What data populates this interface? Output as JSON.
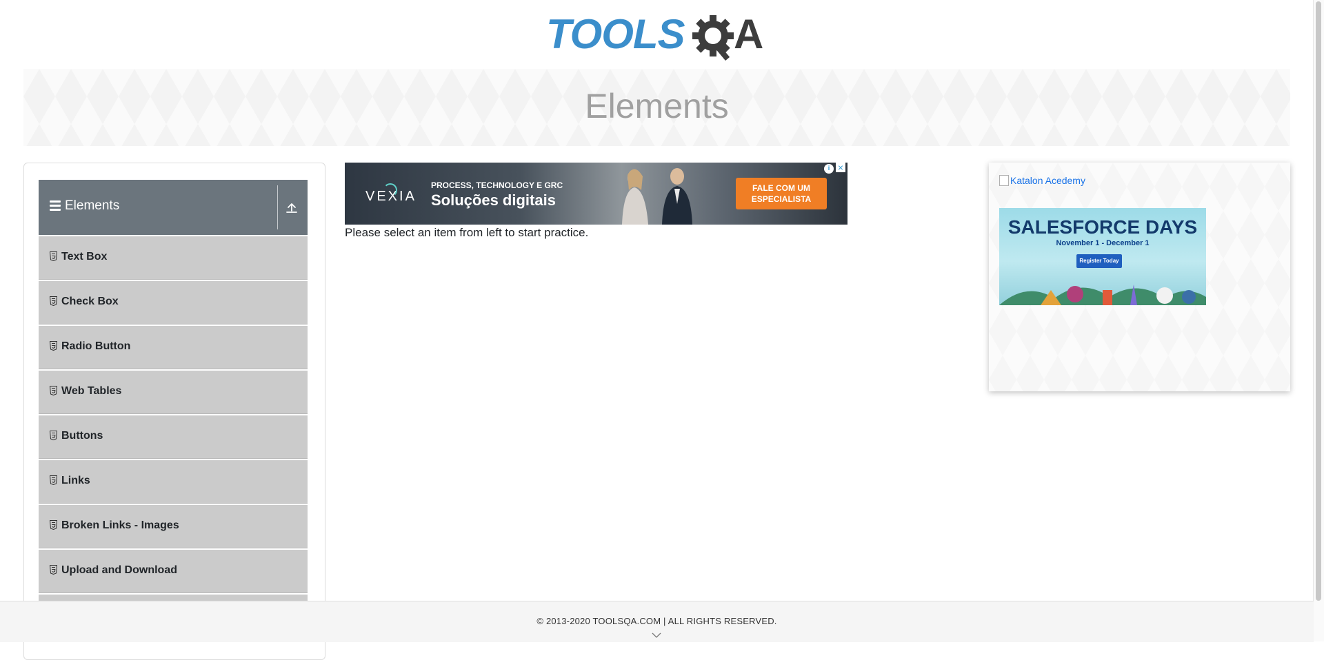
{
  "logo": {
    "text": "TOOLS",
    "letter_a": "A"
  },
  "banner": {
    "title": "Elements"
  },
  "sidebar": {
    "group_title": "Elements",
    "items": [
      {
        "label": "Text Box"
      },
      {
        "label": "Check Box"
      },
      {
        "label": "Radio Button"
      },
      {
        "label": "Web Tables"
      },
      {
        "label": "Buttons"
      },
      {
        "label": "Links"
      },
      {
        "label": "Broken Links - Images"
      },
      {
        "label": "Upload and Download"
      },
      {
        "label": ""
      }
    ]
  },
  "main": {
    "ad": {
      "brand": "VEXIA",
      "kicker": "PROCESS, TECHNOLOGY E GRC",
      "headline": "Soluções digitais",
      "cta_line1": "FALE COM UM",
      "cta_line2": "ESPECIALISTA"
    },
    "instruction": "Please select an item from left to start practice."
  },
  "right": {
    "image_alt": "Katalon Acedemy",
    "ad": {
      "title": "SALESFORCE DAYS",
      "dates": "November 1 - December 1",
      "cta": "Register Today"
    }
  },
  "footer": {
    "copyright": "© 2013-2020 TOOLSQA.COM | ALL RIGHTS RESERVED."
  },
  "colors": {
    "brand_blue": "#3b8ecb",
    "header_gray": "#6b757d",
    "menu_item_bg": "#cbcbcb",
    "cta_orange": "#f07e25"
  },
  "icons": [
    "hamburger-icon",
    "collapse-up-icon",
    "html5-icon",
    "ad-choices-icon",
    "close-icon",
    "broken-image-icon",
    "chevron-down-icon",
    "gear-icon"
  ]
}
